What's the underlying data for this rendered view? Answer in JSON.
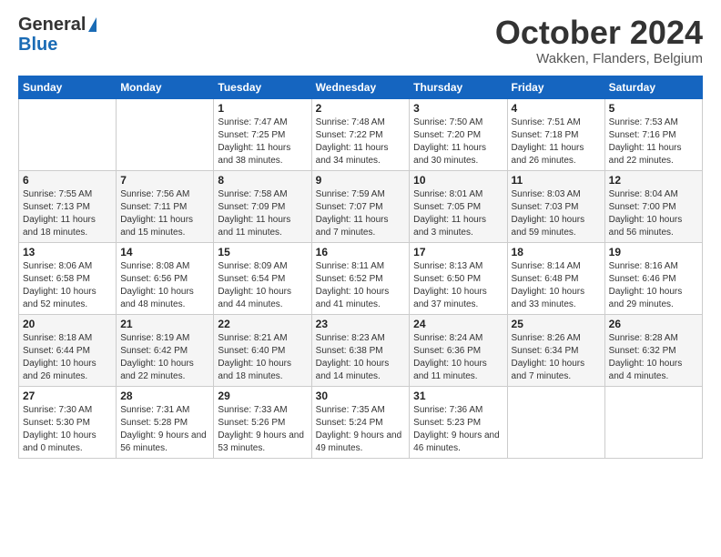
{
  "header": {
    "logo_line1": "General",
    "logo_line2": "Blue",
    "month": "October 2024",
    "location": "Wakken, Flanders, Belgium"
  },
  "weekdays": [
    "Sunday",
    "Monday",
    "Tuesday",
    "Wednesday",
    "Thursday",
    "Friday",
    "Saturday"
  ],
  "weeks": [
    [
      {
        "day": "",
        "info": ""
      },
      {
        "day": "",
        "info": ""
      },
      {
        "day": "1",
        "info": "Sunrise: 7:47 AM\nSunset: 7:25 PM\nDaylight: 11 hours and 38 minutes."
      },
      {
        "day": "2",
        "info": "Sunrise: 7:48 AM\nSunset: 7:22 PM\nDaylight: 11 hours and 34 minutes."
      },
      {
        "day": "3",
        "info": "Sunrise: 7:50 AM\nSunset: 7:20 PM\nDaylight: 11 hours and 30 minutes."
      },
      {
        "day": "4",
        "info": "Sunrise: 7:51 AM\nSunset: 7:18 PM\nDaylight: 11 hours and 26 minutes."
      },
      {
        "day": "5",
        "info": "Sunrise: 7:53 AM\nSunset: 7:16 PM\nDaylight: 11 hours and 22 minutes."
      }
    ],
    [
      {
        "day": "6",
        "info": "Sunrise: 7:55 AM\nSunset: 7:13 PM\nDaylight: 11 hours and 18 minutes."
      },
      {
        "day": "7",
        "info": "Sunrise: 7:56 AM\nSunset: 7:11 PM\nDaylight: 11 hours and 15 minutes."
      },
      {
        "day": "8",
        "info": "Sunrise: 7:58 AM\nSunset: 7:09 PM\nDaylight: 11 hours and 11 minutes."
      },
      {
        "day": "9",
        "info": "Sunrise: 7:59 AM\nSunset: 7:07 PM\nDaylight: 11 hours and 7 minutes."
      },
      {
        "day": "10",
        "info": "Sunrise: 8:01 AM\nSunset: 7:05 PM\nDaylight: 11 hours and 3 minutes."
      },
      {
        "day": "11",
        "info": "Sunrise: 8:03 AM\nSunset: 7:03 PM\nDaylight: 10 hours and 59 minutes."
      },
      {
        "day": "12",
        "info": "Sunrise: 8:04 AM\nSunset: 7:00 PM\nDaylight: 10 hours and 56 minutes."
      }
    ],
    [
      {
        "day": "13",
        "info": "Sunrise: 8:06 AM\nSunset: 6:58 PM\nDaylight: 10 hours and 52 minutes."
      },
      {
        "day": "14",
        "info": "Sunrise: 8:08 AM\nSunset: 6:56 PM\nDaylight: 10 hours and 48 minutes."
      },
      {
        "day": "15",
        "info": "Sunrise: 8:09 AM\nSunset: 6:54 PM\nDaylight: 10 hours and 44 minutes."
      },
      {
        "day": "16",
        "info": "Sunrise: 8:11 AM\nSunset: 6:52 PM\nDaylight: 10 hours and 41 minutes."
      },
      {
        "day": "17",
        "info": "Sunrise: 8:13 AM\nSunset: 6:50 PM\nDaylight: 10 hours and 37 minutes."
      },
      {
        "day": "18",
        "info": "Sunrise: 8:14 AM\nSunset: 6:48 PM\nDaylight: 10 hours and 33 minutes."
      },
      {
        "day": "19",
        "info": "Sunrise: 8:16 AM\nSunset: 6:46 PM\nDaylight: 10 hours and 29 minutes."
      }
    ],
    [
      {
        "day": "20",
        "info": "Sunrise: 8:18 AM\nSunset: 6:44 PM\nDaylight: 10 hours and 26 minutes."
      },
      {
        "day": "21",
        "info": "Sunrise: 8:19 AM\nSunset: 6:42 PM\nDaylight: 10 hours and 22 minutes."
      },
      {
        "day": "22",
        "info": "Sunrise: 8:21 AM\nSunset: 6:40 PM\nDaylight: 10 hours and 18 minutes."
      },
      {
        "day": "23",
        "info": "Sunrise: 8:23 AM\nSunset: 6:38 PM\nDaylight: 10 hours and 14 minutes."
      },
      {
        "day": "24",
        "info": "Sunrise: 8:24 AM\nSunset: 6:36 PM\nDaylight: 10 hours and 11 minutes."
      },
      {
        "day": "25",
        "info": "Sunrise: 8:26 AM\nSunset: 6:34 PM\nDaylight: 10 hours and 7 minutes."
      },
      {
        "day": "26",
        "info": "Sunrise: 8:28 AM\nSunset: 6:32 PM\nDaylight: 10 hours and 4 minutes."
      }
    ],
    [
      {
        "day": "27",
        "info": "Sunrise: 7:30 AM\nSunset: 5:30 PM\nDaylight: 10 hours and 0 minutes."
      },
      {
        "day": "28",
        "info": "Sunrise: 7:31 AM\nSunset: 5:28 PM\nDaylight: 9 hours and 56 minutes."
      },
      {
        "day": "29",
        "info": "Sunrise: 7:33 AM\nSunset: 5:26 PM\nDaylight: 9 hours and 53 minutes."
      },
      {
        "day": "30",
        "info": "Sunrise: 7:35 AM\nSunset: 5:24 PM\nDaylight: 9 hours and 49 minutes."
      },
      {
        "day": "31",
        "info": "Sunrise: 7:36 AM\nSunset: 5:23 PM\nDaylight: 9 hours and 46 minutes."
      },
      {
        "day": "",
        "info": ""
      },
      {
        "day": "",
        "info": ""
      }
    ]
  ]
}
